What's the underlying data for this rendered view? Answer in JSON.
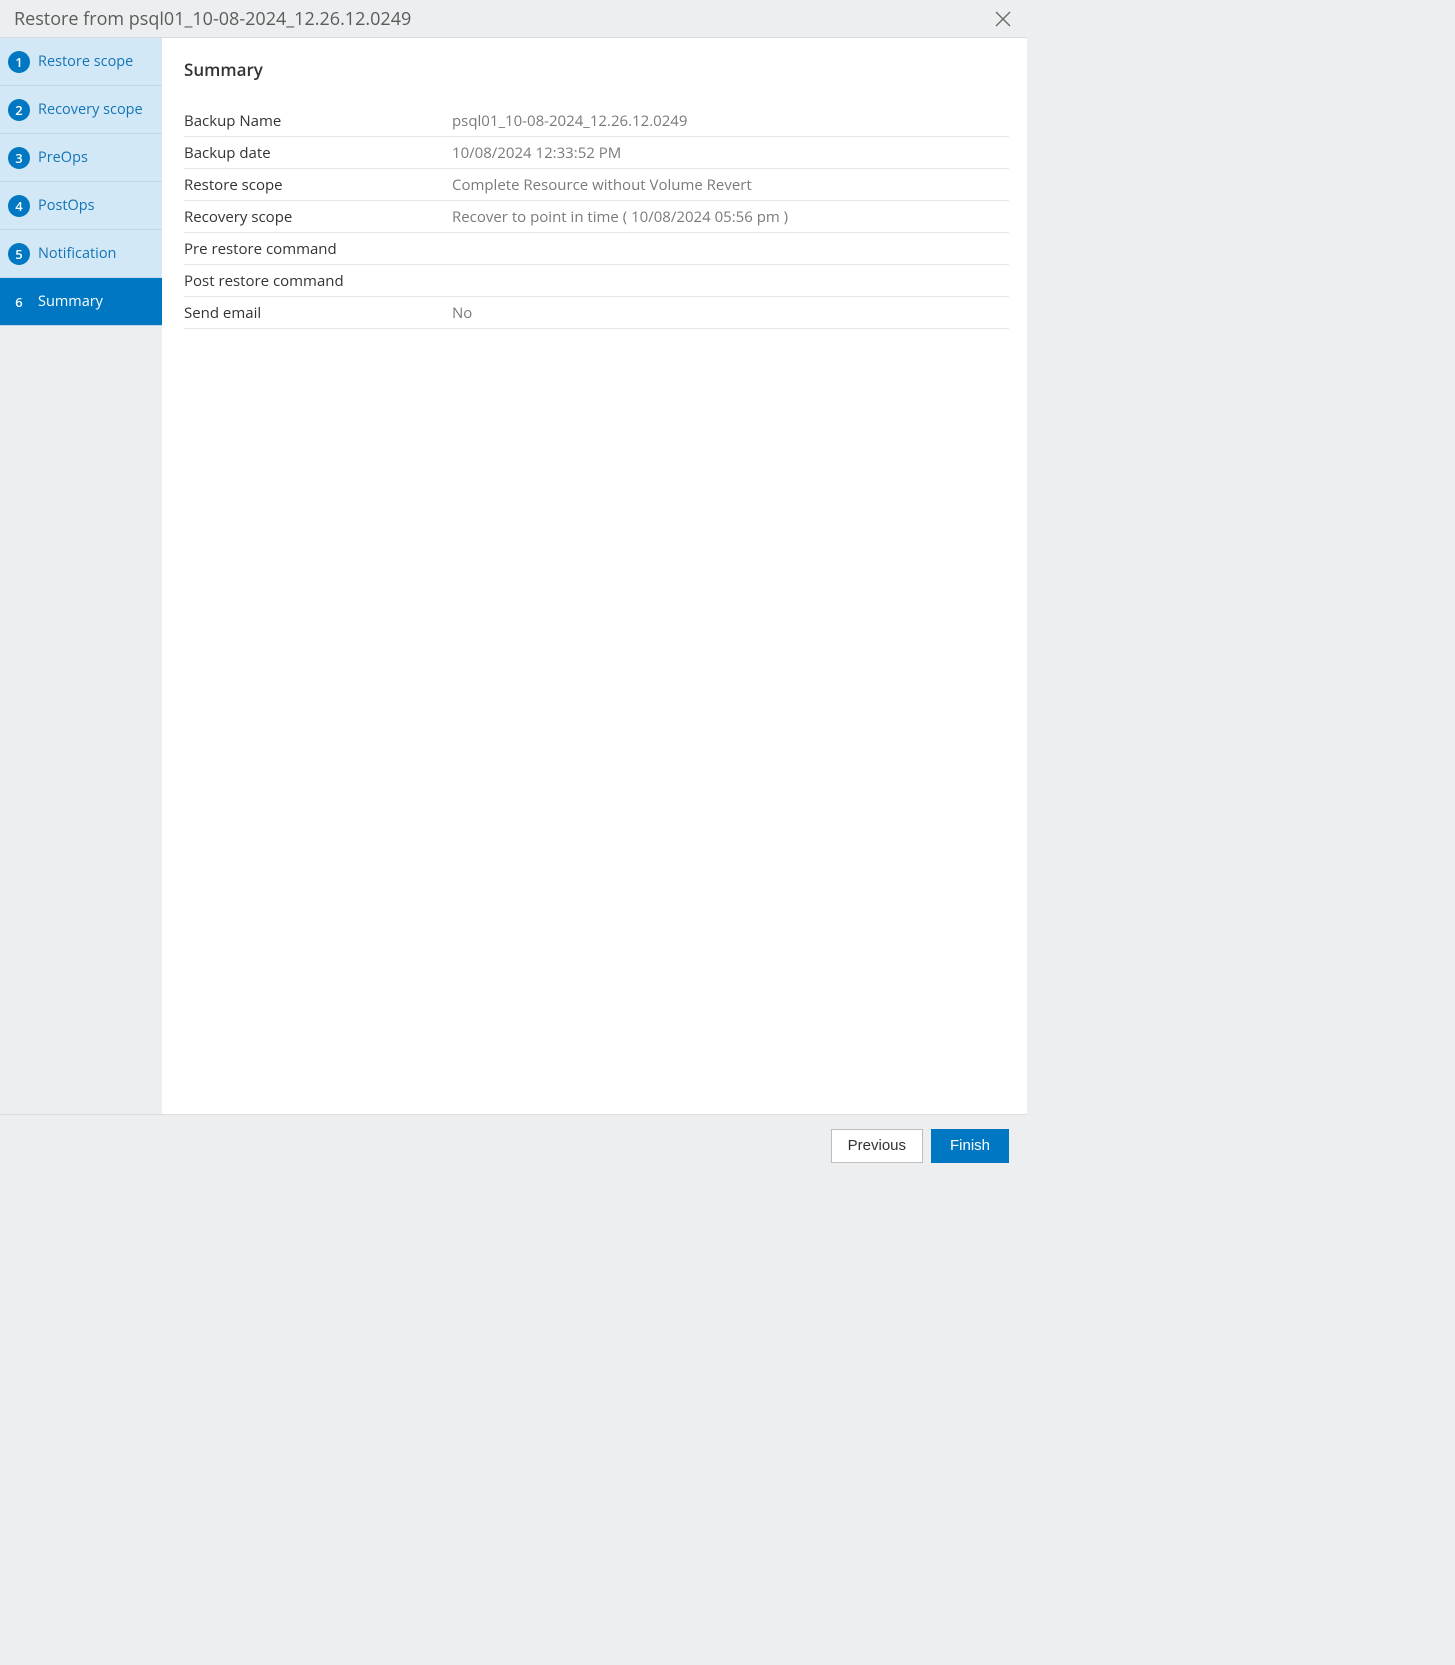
{
  "header": {
    "title": "Restore from psql01_10-08-2024_12.26.12.0249"
  },
  "sidebar": {
    "steps": [
      {
        "num": "1",
        "label": "Restore scope"
      },
      {
        "num": "2",
        "label": "Recovery scope"
      },
      {
        "num": "3",
        "label": "PreOps"
      },
      {
        "num": "4",
        "label": "PostOps"
      },
      {
        "num": "5",
        "label": "Notification"
      },
      {
        "num": "6",
        "label": "Summary"
      }
    ]
  },
  "main": {
    "heading": "Summary",
    "rows": [
      {
        "k": "Backup Name",
        "v": "psql01_10-08-2024_12.26.12.0249"
      },
      {
        "k": "Backup date",
        "v": "10/08/2024 12:33:52 PM"
      },
      {
        "k": "Restore scope",
        "v": "Complete Resource without Volume Revert"
      },
      {
        "k": "Recovery scope",
        "v": "Recover to point in time ( 10/08/2024 05:56 pm )"
      },
      {
        "k": "Pre restore command",
        "v": ""
      },
      {
        "k": "Post restore command",
        "v": ""
      },
      {
        "k": "Send email",
        "v": "No"
      }
    ]
  },
  "footer": {
    "previous": "Previous",
    "finish": "Finish"
  }
}
